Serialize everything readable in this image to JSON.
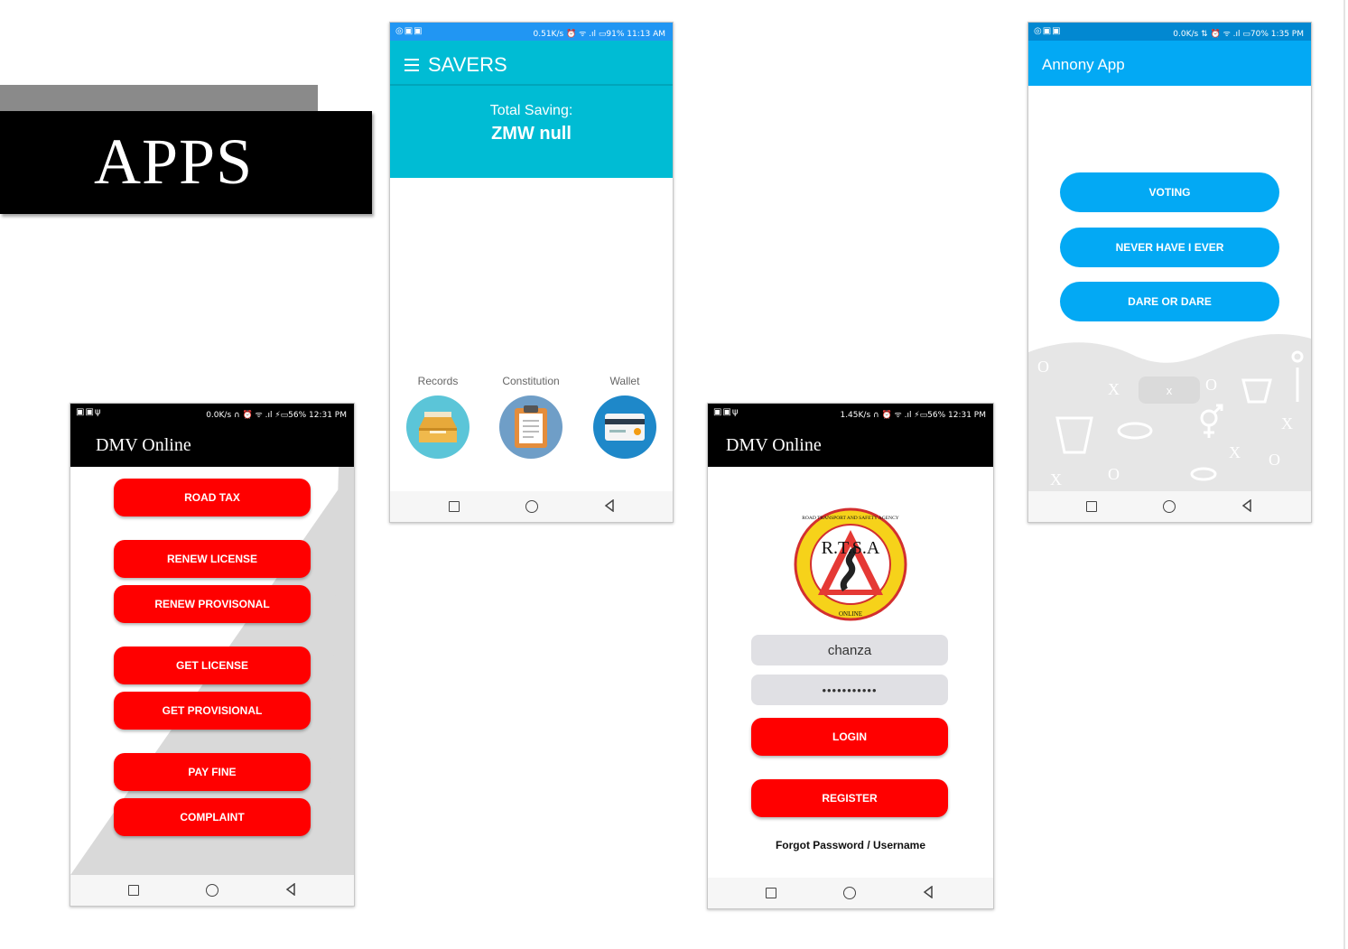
{
  "banner": {
    "title": "APPS"
  },
  "statusbars": {
    "savers": {
      "icons": "◎▣▣",
      "text": "0.51K/s ⏰ ᯤ .ıl ▭91% 11:13 AM"
    },
    "annony": {
      "icons": "◎▣▣",
      "text": "0.0K/s ⇅ ⏰ ᯤ .ıl ▭70% 1:35 PM"
    },
    "dmv_menu": {
      "icons": "▣▣ψ",
      "text": "0.0K/s ∩ ⏰ ᯤ .ıl ⚡▭56% 12:31 PM"
    },
    "dmv_login": {
      "icons": "▣▣ψ",
      "text": "1.45K/s ∩ ⏰ ᯤ .ıl ⚡▭56% 12:31 PM"
    }
  },
  "dmv_menu": {
    "title": "DMV Online",
    "buttons": [
      "ROAD TAX",
      "RENEW LICENSE",
      "RENEW PROVISONAL",
      "GET LICENSE",
      "GET PROVISIONAL",
      "PAY FINE",
      "COMPLAINT"
    ]
  },
  "savers": {
    "app_title": "SAVERS",
    "total_label": "Total Saving:",
    "total_value": "ZMW null",
    "tabs": [
      {
        "label": "Records",
        "icon": "inbox-tray-icon"
      },
      {
        "label": "Constitution",
        "icon": "clipboard-icon"
      },
      {
        "label": "Wallet",
        "icon": "credit-card-icon"
      }
    ]
  },
  "dmv_login": {
    "title": "DMV Online",
    "logo": {
      "top_text": "ROAD TRANSPORT AND SAFETY AGENCY",
      "center_text": "R.T.S.A",
      "bottom_text": "ONLINE"
    },
    "username_value": "chanza",
    "password_value": "•••••••••••",
    "login_label": "LOGIN",
    "register_label": "REGISTER",
    "forgot_label": "Forgot Password / Username"
  },
  "annony": {
    "app_title": "Annony App",
    "buttons": [
      "VOTING",
      "NEVER HAVE I EVER",
      "DARE OR DARE"
    ],
    "pill_label": "x"
  },
  "colors": {
    "red": "#ff0000",
    "cyan": "#00bcd4",
    "blue": "#03a9f4",
    "black": "#000000"
  }
}
